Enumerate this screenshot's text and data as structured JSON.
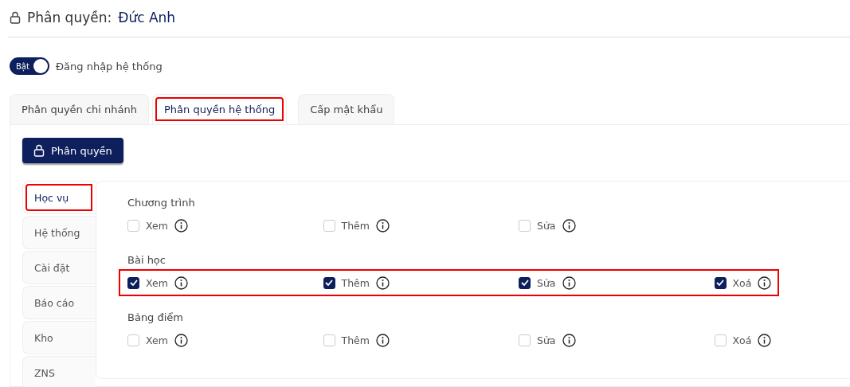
{
  "header": {
    "label": "Phân quyền:",
    "user": "Đức Anh"
  },
  "login_toggle": {
    "on": true,
    "state_label": "Bật",
    "label": "Đăng nhập hệ thống"
  },
  "tabs": [
    {
      "label": "Phân quyền chi nhánh",
      "selected": false,
      "highlighted": false
    },
    {
      "label": "Phân quyền hệ thống",
      "selected": true,
      "highlighted": true
    },
    {
      "label": "Cấp mật khẩu",
      "selected": false,
      "highlighted": false
    }
  ],
  "action_button": "Phân quyền",
  "sidebar": {
    "items": [
      {
        "label": "Học vụ",
        "selected": true,
        "highlighted": true
      },
      {
        "label": "Hệ thống",
        "selected": false,
        "highlighted": false
      },
      {
        "label": "Cài đặt",
        "selected": false,
        "highlighted": false
      },
      {
        "label": "Báo cáo",
        "selected": false,
        "highlighted": false
      },
      {
        "label": "Kho",
        "selected": false,
        "highlighted": false
      },
      {
        "label": "ZNS",
        "selected": false,
        "highlighted": false
      }
    ]
  },
  "groups": [
    {
      "title": "Chương trình",
      "highlighted": false,
      "permissions": [
        {
          "label": "Xem",
          "checked": false
        },
        {
          "label": "Thêm",
          "checked": false
        },
        {
          "label": "Sửa",
          "checked": false
        }
      ]
    },
    {
      "title": "Bài học",
      "highlighted": true,
      "permissions": [
        {
          "label": "Xem",
          "checked": true
        },
        {
          "label": "Thêm",
          "checked": true
        },
        {
          "label": "Sửa",
          "checked": true
        },
        {
          "label": "Xoá",
          "checked": true
        }
      ]
    },
    {
      "title": "Bảng điểm",
      "highlighted": false,
      "permissions": [
        {
          "label": "Xem",
          "checked": false
        },
        {
          "label": "Thêm",
          "checked": false
        },
        {
          "label": "Sửa",
          "checked": false
        },
        {
          "label": "Xoá",
          "checked": false
        }
      ]
    }
  ]
}
